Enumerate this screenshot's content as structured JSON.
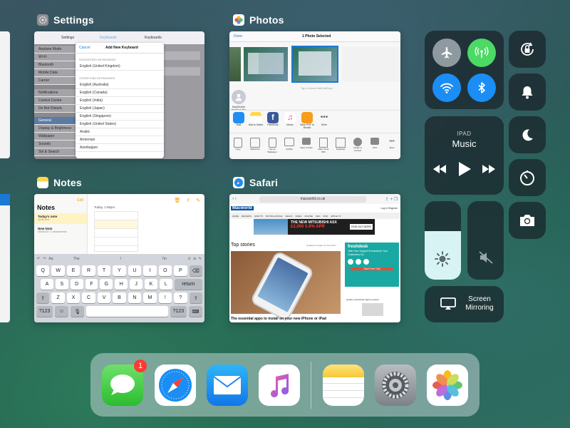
{
  "apps": {
    "settings": {
      "label": "Settings"
    },
    "photos": {
      "label": "Photos"
    },
    "notes": {
      "label": "Notes"
    },
    "safari": {
      "label": "Safari"
    }
  },
  "settings_card": {
    "nav_title": "Settings",
    "nav_back": "Keyboards",
    "nav_right": "Keyboards",
    "sidebar": [
      "Airplane Mode",
      "Wi-Fi",
      "Bluetooth",
      "Mobile Data",
      "Carrier",
      "Notifications",
      "Control Centre",
      "Do Not Disturb",
      "General",
      "Display & Brightness",
      "Wallpaper",
      "Sounds",
      "Siri & Search"
    ],
    "modal": {
      "cancel": "Cancel",
      "title": "Add New Keyboard",
      "suggested_header": "SUGGESTED KEYBOARDS",
      "suggested": [
        "English (United Kingdom)"
      ],
      "other_header": "OTHER IPAD KEYBOARDS",
      "other": [
        "English (Australia)",
        "English (Canada)",
        "English (India)",
        "English (Japan)",
        "English (Singapore)",
        "English (United States)",
        "Arabic",
        "Armenian",
        "Azerbaijani"
      ]
    }
  },
  "photos_card": {
    "done": "Done",
    "title": "1 Photo Selected",
    "airdrop_hint": "Tap to share with AirDrop",
    "contact_name": "MacWorld’s MacBook Pro",
    "share_apps": [
      "Mail",
      "Add to Notes",
      "Facebook",
      "Music",
      "Save PDF to iBooks",
      "More"
    ],
    "actions": [
      "Copy",
      "Slideshow",
      "Use as Wallpaper",
      "AirPlay",
      "Save to Files",
      "Mark Up as PDF",
      "Duplicate",
      "Assign to Contact",
      "Print",
      "More"
    ]
  },
  "notes_card": {
    "header": "Notes",
    "edit": "Edit",
    "date_line": "Today, 1:05pm",
    "items": [
      {
        "title": "Today’s note",
        "sub": "16:05  Text"
      },
      {
        "title": "New Note",
        "sub": "05/06/2017  3 attachments"
      }
    ],
    "search": "Search",
    "keyboard_suggestions": [
      "The",
      "I",
      "I'm"
    ],
    "kb_rows": [
      [
        "Q",
        "W",
        "E",
        "R",
        "T",
        "Y",
        "U",
        "I",
        "O",
        "P"
      ],
      [
        "A",
        "S",
        "D",
        "F",
        "G",
        "H",
        "J",
        "K",
        "L"
      ],
      [
        "Z",
        "X",
        "C",
        "V",
        "B",
        "N",
        "M",
        "!",
        "?"
      ]
    ],
    "return": "return",
    "numbers": "?123"
  },
  "safari_card": {
    "url": "macworld.co.uk",
    "site": "Macworld",
    "login": "Log in   Register",
    "nav": [
      "HOME",
      "REVIEWS",
      "HOW TO",
      "BUYING ADVICE",
      "DEALS",
      "VIDEO",
      "iPHONE",
      "MAC",
      "iPAD",
      "APPLE TV"
    ],
    "ad_headline": "THE NEW MITSUBISHI ASX",
    "ad_price": "£2,000  5.9% APR",
    "ad_cta": "FIND OUT MORE",
    "section": "Top stories",
    "updated": "Updated 12:14pm  11 July 2017",
    "headline": "The essential apps to install on your new iPhone or iPad",
    "sidebar_brand": "freshdesk",
    "sidebar_text": "Take Your Support Everywhere Your Customers Go",
    "sidebar_cta": "Start Free Trial",
    "sidebar_story": "Quality refurbished Apple products"
  },
  "control_center": {
    "music_device": "IPAD",
    "music_title": "Music",
    "screen_mirroring": "Screen Mirroring",
    "brightness_level": 0.62,
    "volume_level": 0.0,
    "colors": {
      "airplane_bg": "#8e9aa0",
      "cellular_bg": "#4cd964",
      "wifi_bg": "#1a8ef5",
      "bluetooth_bg": "#1a8ef5",
      "brightness": "#d8f3f3"
    }
  },
  "dock": {
    "badge_messages": "1",
    "apps": [
      "messages-icon",
      "safari-icon",
      "mail-icon",
      "music-icon",
      "notes-icon",
      "settings-icon",
      "photos-icon"
    ]
  }
}
